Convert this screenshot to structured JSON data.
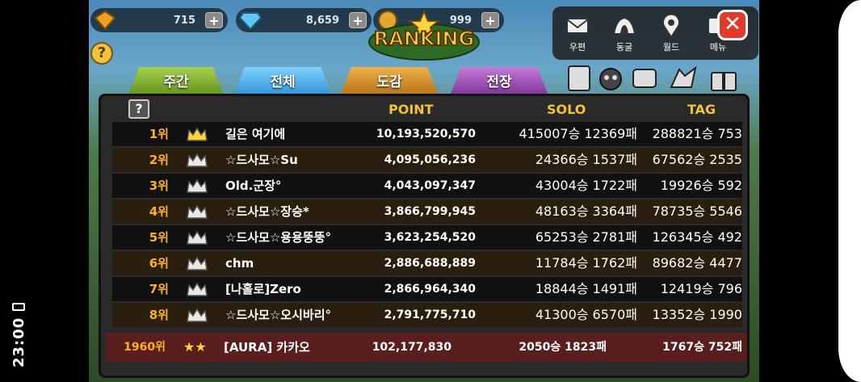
{
  "system": {
    "clock": "23:00"
  },
  "resources": [
    {
      "icon": "gold-gem-icon",
      "value": "715"
    },
    {
      "icon": "blue-diamond-icon",
      "value": "8,659"
    },
    {
      "icon": "coin-icon",
      "value": "999"
    }
  ],
  "title": "RANKING",
  "menu": [
    {
      "label": "우편",
      "icon": "mail-icon"
    },
    {
      "label": "동굴",
      "icon": "cave-icon"
    },
    {
      "label": "월드",
      "icon": "map-pin-icon"
    },
    {
      "label": "메뉴",
      "icon": "menu-icon"
    }
  ],
  "tabs": [
    {
      "label": "주간"
    },
    {
      "label": "전체"
    },
    {
      "label": "도감"
    },
    {
      "label": "전장"
    }
  ],
  "help_label": "?",
  "headers": {
    "point": "POINT",
    "solo": "SOLO",
    "tag": "TAG"
  },
  "rows": [
    {
      "rank": "1위",
      "name": "길은 여기에",
      "point": "10,193,520,570",
      "solo": "415007승 12369패",
      "tag": "288821승 753"
    },
    {
      "rank": "2위",
      "name": "☆드사모☆Su",
      "point": "4,095,056,236",
      "solo": "24366승 1537패",
      "tag": "67562승 2535"
    },
    {
      "rank": "3위",
      "name": "Old.군장°",
      "point": "4,043,097,347",
      "solo": "43004승 1722패",
      "tag": "19926승 592"
    },
    {
      "rank": "4위",
      "name": "☆드사모☆장승*",
      "point": "3,866,799,945",
      "solo": "48163승 3364패",
      "tag": "78735승 5546"
    },
    {
      "rank": "5위",
      "name": "☆드사모☆용용뚱뚱°",
      "point": "3,623,254,520",
      "solo": "65253승 2781패",
      "tag": "126345승 492"
    },
    {
      "rank": "6위",
      "name": "chm",
      "point": "2,886,688,889",
      "solo": "11784승 1762패",
      "tag": "89682승 4477"
    },
    {
      "rank": "7위",
      "name": "[나홀로]Zero",
      "point": "2,866,964,340",
      "solo": "18844승 1491패",
      "tag": "12419승 796"
    },
    {
      "rank": "8위",
      "name": "☆드사모☆오시바리°",
      "point": "2,791,775,710",
      "solo": "41300승 6570패",
      "tag": "13352승 1990"
    }
  ],
  "my_row": {
    "rank": "1960위",
    "name": "[AURA] 카카오",
    "point": "102,177,830",
    "solo": "2050승 1823패",
    "tag": "1767승 752패"
  },
  "colors": {
    "accent": "#f2c23a",
    "rank": "#ffb020",
    "close": "#e23a2a",
    "my_row_bg": "#5a1e1e"
  }
}
